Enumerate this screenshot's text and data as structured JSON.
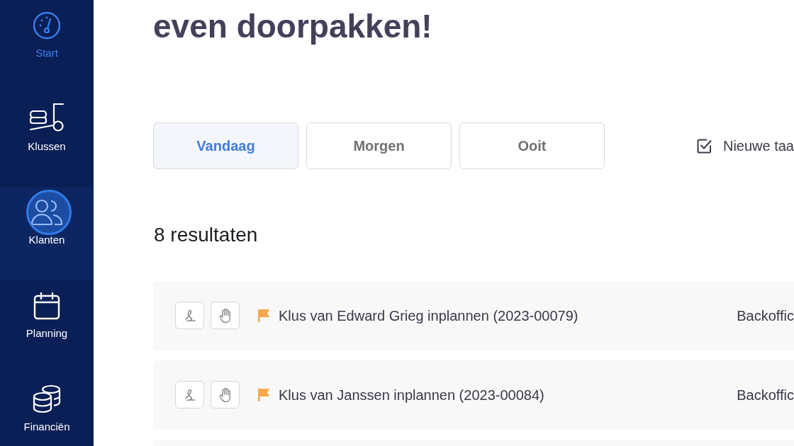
{
  "sidebar": {
    "items": [
      {
        "kind": "dashboard",
        "label": "Start",
        "selected": true,
        "clicked": false
      },
      {
        "kind": "jobs",
        "label": "Klussen",
        "selected": false,
        "clicked": false
      },
      {
        "kind": "customers",
        "label": "Klanten",
        "selected": false,
        "clicked": true
      },
      {
        "kind": "planning",
        "label": "Planning",
        "selected": false,
        "clicked": false
      },
      {
        "kind": "finance",
        "label": "Financiën",
        "selected": false,
        "clicked": false
      }
    ]
  },
  "heading": "even doorpakken!",
  "tabs": [
    {
      "label": "Vandaag",
      "selected": true
    },
    {
      "label": "Morgen",
      "selected": false
    },
    {
      "label": "Ooit",
      "selected": false
    }
  ],
  "new_task": {
    "label": "Nieuwe taa"
  },
  "results": "8 resultaten",
  "tasks": [
    {
      "title": "Klus van Edward Grieg inplannen (2023-00079)",
      "flagged": true,
      "assignee": "Backoffic"
    },
    {
      "title": "Klus van Janssen inplannen (2023-00084)",
      "flagged": true,
      "assignee": "Backoffic"
    }
  ]
}
